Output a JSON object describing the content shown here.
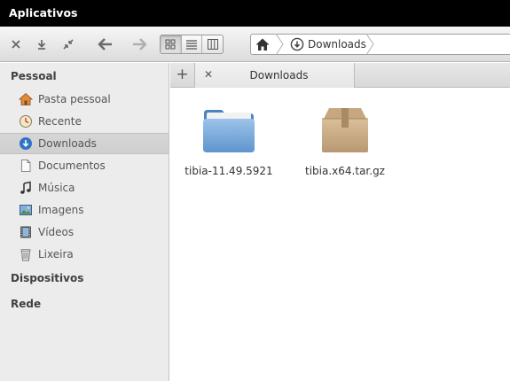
{
  "window": {
    "title": "Aplicativos"
  },
  "toolbar": {
    "buttons": [
      "close-icon",
      "download-icon",
      "shrink-icon",
      "arrow-left-icon",
      "arrow-right-icon"
    ],
    "views": [
      "grid-view-icon",
      "list-view-icon",
      "column-view-icon"
    ],
    "active_view": 0
  },
  "pathbar": {
    "current": "Downloads"
  },
  "sidebar": {
    "sections": [
      {
        "title": "Pessoal",
        "items": [
          {
            "label": "Pasta pessoal",
            "icon": "home-icon"
          },
          {
            "label": "Recente",
            "icon": "clock-icon"
          },
          {
            "label": "Downloads",
            "icon": "download-icon",
            "selected": true
          },
          {
            "label": "Documentos",
            "icon": "document-icon"
          },
          {
            "label": "Música",
            "icon": "music-icon"
          },
          {
            "label": "Imagens",
            "icon": "image-icon"
          },
          {
            "label": "Vídeos",
            "icon": "film-icon"
          },
          {
            "label": "Lixeira",
            "icon": "trash-icon"
          }
        ]
      },
      {
        "title": "Dispositivos",
        "items": []
      },
      {
        "title": "Rede",
        "items": []
      }
    ]
  },
  "tabs": [
    {
      "label": "Downloads"
    }
  ],
  "files": [
    {
      "name": "tibia-11.49.5921",
      "type": "folder",
      "icon": "folder-icon"
    },
    {
      "name": "tibia.x64.tar.gz",
      "type": "archive",
      "icon": "archive-icon"
    }
  ],
  "colors": {
    "topbar": "#000000",
    "accent": "#2f73c8",
    "folder": "#6fa4d8",
    "archive": "#c9ab85"
  }
}
